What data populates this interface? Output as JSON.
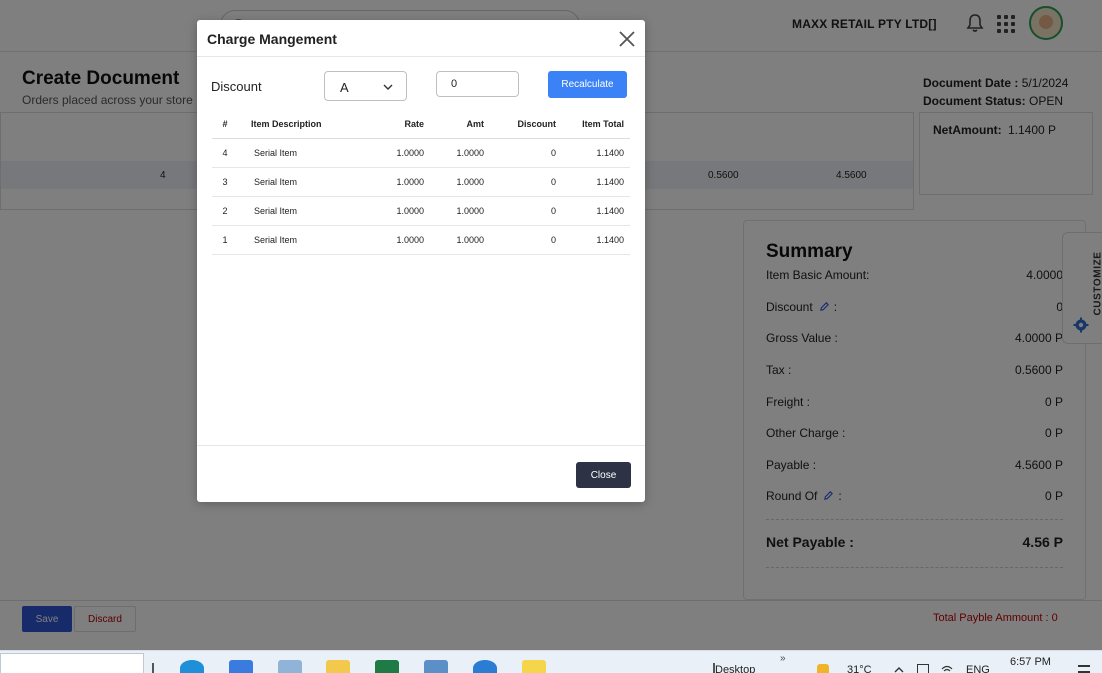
{
  "topbar": {
    "company_name": "MAXX RETAIL PTY LTD[]"
  },
  "page": {
    "title": "Create Document",
    "subtitle": "Orders placed across your store",
    "document_date_label": "Document Date :",
    "document_date": "5/1/2024",
    "document_status_label": "Document Status:",
    "document_status": "OPEN"
  },
  "background_table": {
    "row_first_value": "4",
    "row_tax_value": "0.5600",
    "row_total_value": "4.5600"
  },
  "net_amount_box": {
    "label": "NetAmount:",
    "value": "1.1400 P"
  },
  "summary": {
    "title": "Summary",
    "rows": [
      {
        "label": "Item Basic Amount:",
        "value": "4.0000"
      },
      {
        "label": "Discount",
        "suffix": ":",
        "value": "0"
      },
      {
        "label": "Gross Value :",
        "value": "4.0000 P"
      },
      {
        "label": "Tax :",
        "value": "0.5600 P"
      },
      {
        "label": "Freight :",
        "value": "0 P"
      },
      {
        "label": "Other Charge :",
        "value": "0 P"
      },
      {
        "label": "Payable :",
        "value": "4.5600 P"
      },
      {
        "label": "Round Of",
        "suffix": ":",
        "value": "0 P"
      }
    ],
    "net_payable_label": "Net Payable :",
    "net_payable_value": "4.56 P"
  },
  "customize_tab": {
    "label": "CUSTOMIZE"
  },
  "footer": {
    "save_label": "Save",
    "discard_label": "Discard",
    "total_payable": "Total Payble Ammount : 0"
  },
  "modal": {
    "title": "Charge Mangement",
    "discount_label": "Discount",
    "discount_type_selected": "A",
    "discount_value": "0",
    "recalculate_label": "Recalculate",
    "close_label": "Close",
    "table": {
      "headers": [
        "#",
        "Item Description",
        "Rate",
        "Amt",
        "Discount",
        "Item Total"
      ],
      "rows": [
        [
          "4",
          "Serial Item",
          "1.0000",
          "1.0000",
          "0",
          "1.1400"
        ],
        [
          "3",
          "Serial Item",
          "1.0000",
          "1.0000",
          "0",
          "1.1400"
        ],
        [
          "2",
          "Serial Item",
          "1.0000",
          "1.0000",
          "0",
          "1.1400"
        ],
        [
          "1",
          "Serial Item",
          "1.0000",
          "1.0000",
          "0",
          "1.1400"
        ]
      ]
    }
  },
  "taskbar": {
    "desktop_label": "Desktop",
    "chevron": "»",
    "weather": "31°C",
    "language": "ENG",
    "time": "6:57 PM",
    "apps": [
      "edge-icon",
      "app-blue-icon",
      "notepad-icon",
      "file-explorer-icon",
      "excel-icon",
      "app-grid-icon",
      "mail-icon",
      "sticky-notes-icon"
    ]
  }
}
